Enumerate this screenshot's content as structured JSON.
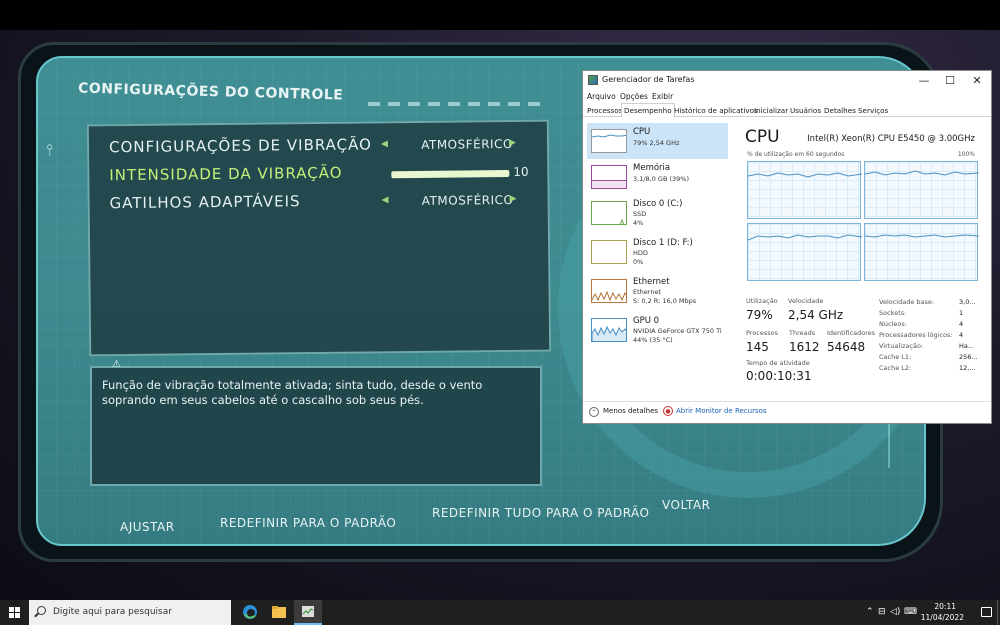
{
  "game": {
    "title": "CONFIGURAÇÕES DO CONTROLE",
    "settings": [
      {
        "label": "CONFIGURAÇÕES DE VIBRAÇÃO",
        "value": "ATMOSFÉRICO"
      },
      {
        "label": "INTENSIDADE DA VIBRAÇÃO",
        "slider_value": "10",
        "slider_fraction": 1.0
      },
      {
        "label": "GATILHOS ADAPTÁVEIS",
        "value": "ATMOSFÉRICO"
      }
    ],
    "description": "Função de vibração totalmente ativada; sinta tudo, desde o vento soprando em seus cabelos até o cascalho sob seus pés.",
    "buttons": {
      "adjust": "AJUSTAR",
      "reset_default": "REDEFINIR PARA O PADRÃO",
      "reset_all_default": "REDEFINIR TUDO PARA O PADRÃO",
      "back": "VOLTAR"
    }
  },
  "taskmgr": {
    "title": "Gerenciador de Tarefas",
    "menu": [
      "Arquivo",
      "Opções",
      "Exibir"
    ],
    "tabs": [
      "Processos",
      "Desempenho",
      "Histórico de aplicativos",
      "Inicializar",
      "Usuários",
      "Detalhes",
      "Serviços"
    ],
    "active_tab": "Desempenho",
    "resources": [
      {
        "name": "CPU",
        "sub1": "79% 2,54 GHz",
        "sub2": "",
        "sub3": ""
      },
      {
        "name": "Memória",
        "sub1": "3,1/8,0 GB (39%)",
        "sub2": "",
        "sub3": ""
      },
      {
        "name": "Disco 0 (C:)",
        "sub1": "SSD",
        "sub2": "4%",
        "sub3": ""
      },
      {
        "name": "Disco 1 (D: F:)",
        "sub1": "HDD",
        "sub2": "0%",
        "sub3": ""
      },
      {
        "name": "Ethernet",
        "sub1": "Ethernet",
        "sub2": "S: 0,2  R: 16,0 Mbps",
        "sub3": ""
      },
      {
        "name": "GPU 0",
        "sub1": "NVIDIA GeForce GTX 750 Ti",
        "sub2": "44% (35 °C)",
        "sub3": ""
      }
    ],
    "cpu": {
      "heading": "CPU",
      "model": "Intel(R) Xeon(R) CPU E5450 @ 3.00GHz",
      "graph_caption": "% de utilização em 60 segundos",
      "graph_max": "100%",
      "stats": {
        "utilization_label": "Utilização",
        "utilization": "79%",
        "speed_label": "Velocidade",
        "speed": "2,54 GHz",
        "processes_label": "Processos",
        "processes": "145",
        "threads_label": "Threads",
        "threads": "1612",
        "handles_label": "Identificadores",
        "handles": "54648",
        "uptime_label": "Tempo de atividade",
        "uptime": "0:00:10:31"
      },
      "specs": [
        {
          "label": "Velocidade base:",
          "value": "3,0..."
        },
        {
          "label": "Sockets:",
          "value": "1"
        },
        {
          "label": "Núcleos:",
          "value": "4"
        },
        {
          "label": "Processadores lógicos:",
          "value": "4"
        },
        {
          "label": "Virtualização:",
          "value": "Ha..."
        },
        {
          "label": "Cache L1:",
          "value": "256..."
        },
        {
          "label": "Cache L2:",
          "value": "12,..."
        }
      ]
    },
    "footer": {
      "less_details": "Menos detalhes",
      "resource_monitor": "Abrir Monitor de Recursos"
    }
  },
  "taskbar": {
    "search_placeholder": "Digite aqui para pesquisar",
    "time": "20:11",
    "date": "11/04/2022"
  },
  "colors": {
    "game_screen": "#3d8a8f",
    "game_accent": "#c5ef7a",
    "tm_selected": "#cce4f7",
    "graph_line": "#4a90c4",
    "taskbar": "#1f1f1f"
  }
}
